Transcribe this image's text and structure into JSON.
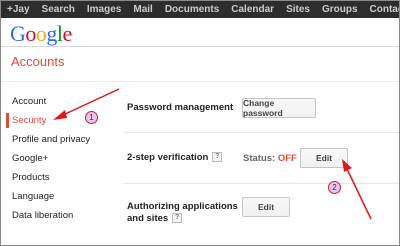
{
  "topbar": {
    "links": [
      "+Jay",
      "Search",
      "Images",
      "Mail",
      "Documents",
      "Calendar",
      "Sites",
      "Groups",
      "Contacts",
      "Mo"
    ]
  },
  "logo": {
    "letters": [
      "G",
      "o",
      "o",
      "g",
      "l",
      "e"
    ],
    "colors": [
      "#3369e8",
      "#d50f25",
      "#eeb211",
      "#3369e8",
      "#009925",
      "#d50f25"
    ]
  },
  "page": {
    "title": "Accounts"
  },
  "sidebar": {
    "items": [
      {
        "label": "Account",
        "active": false
      },
      {
        "label": "Security",
        "active": true
      },
      {
        "label": "Profile and privacy",
        "active": false
      },
      {
        "label": "Google+",
        "active": false
      },
      {
        "label": "Products",
        "active": false
      },
      {
        "label": "Language",
        "active": false
      },
      {
        "label": "Data liberation",
        "active": false
      }
    ]
  },
  "security": {
    "password": {
      "label": "Password management",
      "button": "Change password"
    },
    "two_step": {
      "label": "2-step verification",
      "help": "?",
      "status_label": "Status:",
      "status_value": "OFF",
      "button": "Edit"
    },
    "authorizing": {
      "label_line1": "Authorizing applications",
      "label_line2": "and sites",
      "help": "?",
      "button": "Edit"
    }
  },
  "annotations": {
    "badge1": "1",
    "badge2": "2",
    "arrow_color": "#e0161a"
  },
  "colors": {
    "accent": "#dd4b39",
    "topbar_bg": "#2d2d2d"
  }
}
